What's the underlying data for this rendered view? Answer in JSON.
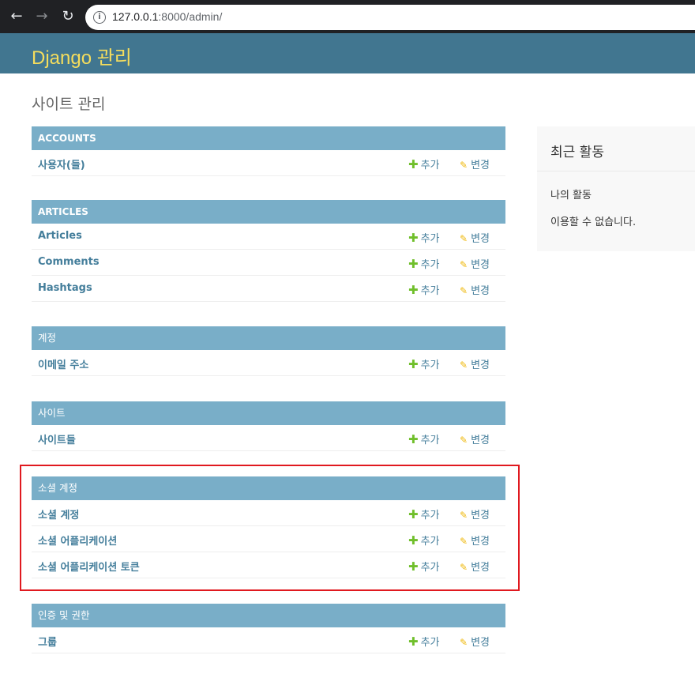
{
  "browser": {
    "url_host": "127.0.0.1",
    "url_path": ":8000/admin/"
  },
  "header": {
    "brand": "Django 관리"
  },
  "page_title": "사이트 관리",
  "modules": [
    {
      "caption": "ACCOUNTS",
      "rows": [
        {
          "name": "사용자(들)",
          "add": "추가",
          "change": "변경"
        }
      ]
    },
    {
      "caption": "ARTICLES",
      "rows": [
        {
          "name": "Articles",
          "add": "추가",
          "change": "변경"
        },
        {
          "name": "Comments",
          "add": "추가",
          "change": "변경"
        },
        {
          "name": "Hashtags",
          "add": "추가",
          "change": "변경"
        }
      ]
    },
    {
      "caption": "계정",
      "rows": [
        {
          "name": "이메일 주소",
          "add": "추가",
          "change": "변경"
        }
      ]
    },
    {
      "caption": "사이트",
      "rows": [
        {
          "name": "사이트들",
          "add": "추가",
          "change": "변경"
        }
      ]
    },
    {
      "caption": "소셜 계정",
      "rows": [
        {
          "name": "소셜 계정",
          "add": "추가",
          "change": "변경"
        },
        {
          "name": "소셜 어플리케이션",
          "add": "추가",
          "change": "변경"
        },
        {
          "name": "소셜 어플리케이션 토큰",
          "add": "추가",
          "change": "변경"
        }
      ]
    },
    {
      "caption": "인증 및 권한",
      "rows": [
        {
          "name": "그룹",
          "add": "추가",
          "change": "변경"
        }
      ]
    }
  ],
  "sidebar": {
    "title": "최근 활동",
    "subtitle": "나의 활동",
    "empty": "이용할 수 없습니다."
  },
  "colors": {
    "header_bg": "#417690",
    "brand": "#f5dd5d",
    "caption_bg": "#79aec8",
    "link": "#447e9b",
    "add_icon": "#70bf2b",
    "change_icon": "#efb80b",
    "highlight": "#e0191f"
  },
  "icons": {
    "add": "plus-icon",
    "change": "pencil-icon",
    "back": "arrow-left-icon",
    "forward": "arrow-right-icon",
    "reload": "reload-icon",
    "info": "info-icon"
  }
}
